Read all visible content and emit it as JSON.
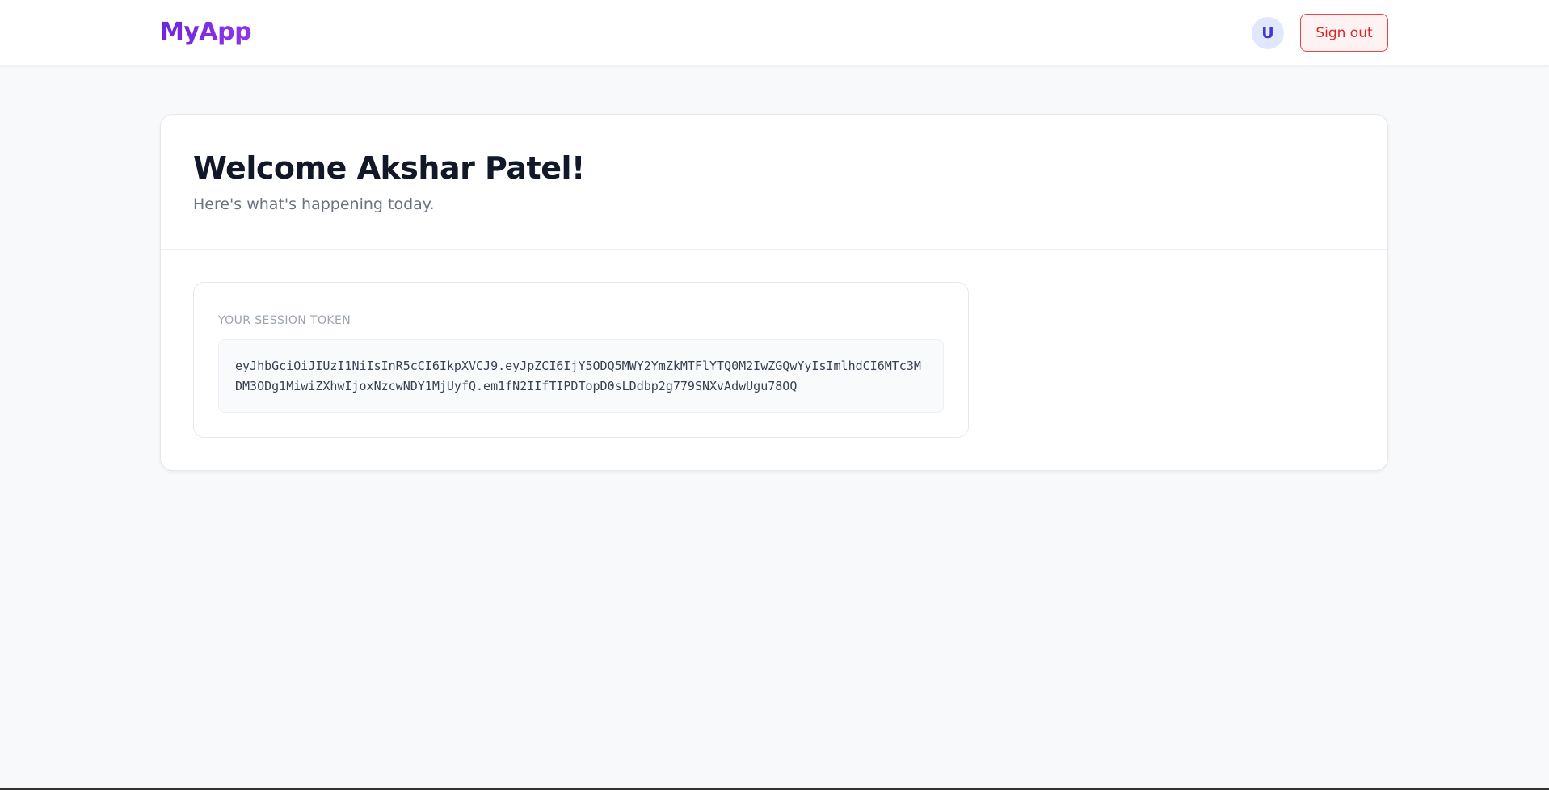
{
  "header": {
    "brand": "MyApp",
    "avatar_initial": "U",
    "signout_label": "Sign out"
  },
  "welcome": {
    "title": "Welcome Akshar Patel!",
    "subtitle": "Here's what's happening today."
  },
  "session": {
    "label": "YOUR SESSION TOKEN",
    "token": "eyJhbGciOiJIUzI1NiIsInR5cCI6IkpXVCJ9.eyJpZCI6IjY5ODQ5MWY2YmZkMTFlYTQ0M2IwZGQwYyIsImlhdCI6MTc3MDM3ODg1MiwiZXhwIjoxNzcwNDY1MjUyfQ.em1fN2IIfTIPDTopD0sLDdbp2g779SNXvAdwUgu78OQ"
  },
  "colors": {
    "brand_gradient_start": "#6d28d9",
    "brand_gradient_end": "#9333ea",
    "signout_border": "#ef4444",
    "signout_text": "#dc2626",
    "avatar_bg": "#e0e7ff",
    "avatar_text": "#4338ca",
    "page_bg": "#f8f9fb"
  }
}
